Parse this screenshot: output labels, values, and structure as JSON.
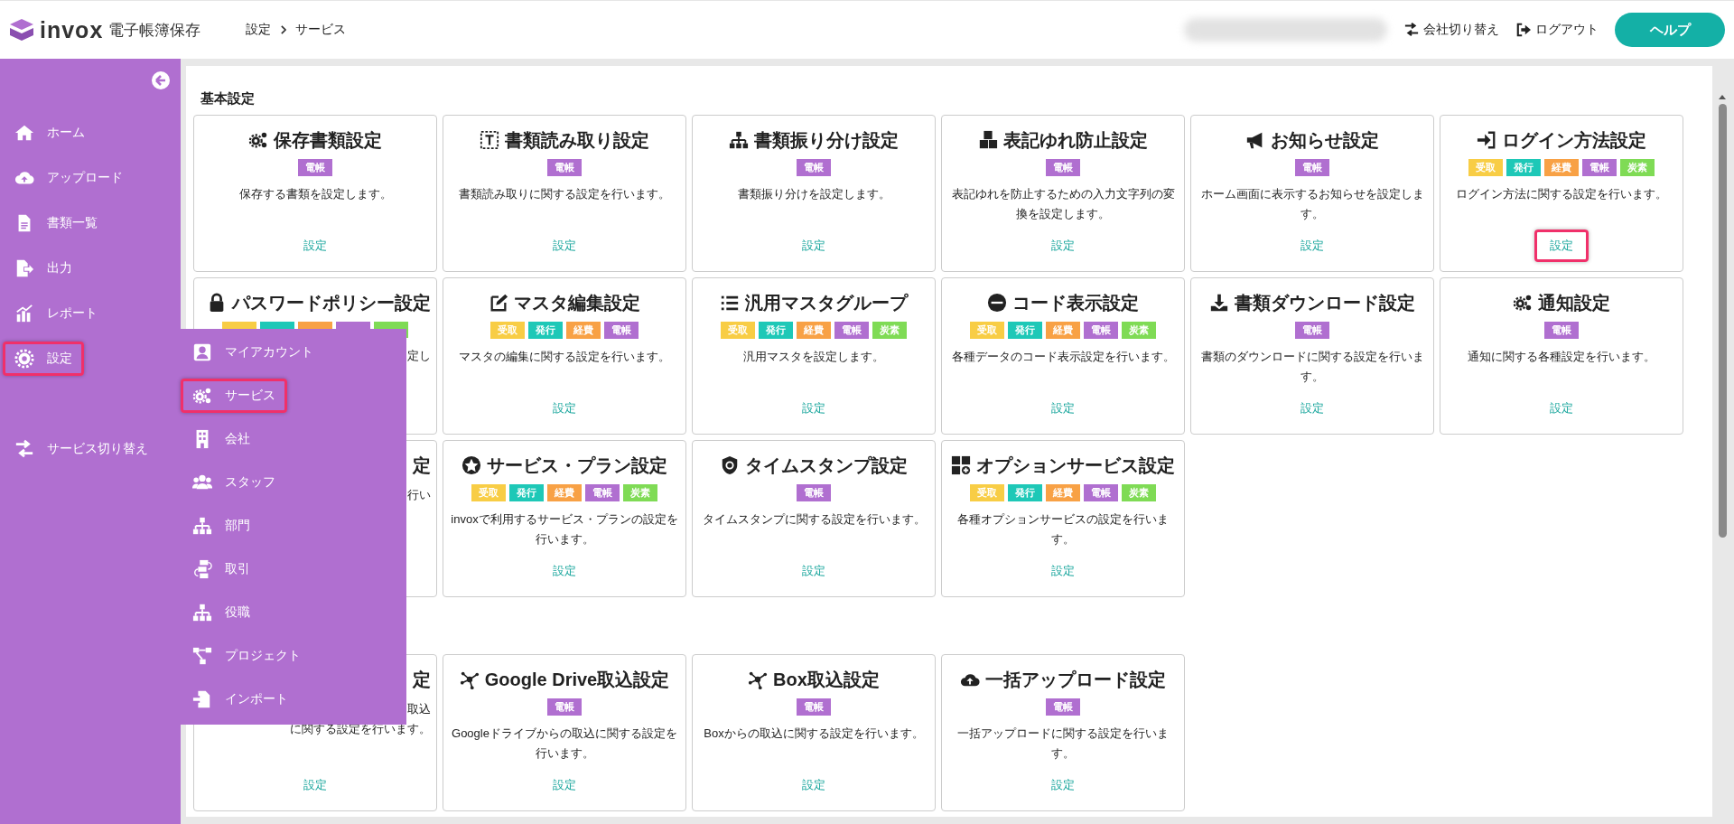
{
  "header": {
    "logo": {
      "brand": "invox",
      "product": "電子帳簿保存"
    },
    "breadcrumb": [
      "設定",
      "サービス"
    ],
    "actions": [
      {
        "label": "会社切り替え"
      },
      {
        "label": "ログアウト"
      }
    ],
    "help_button": "ヘルプ"
  },
  "sidebar": {
    "items": [
      {
        "label": "ホーム",
        "highlighted": false
      },
      {
        "label": "アップロード",
        "highlighted": false
      },
      {
        "label": "書類一覧",
        "highlighted": false
      },
      {
        "label": "出力",
        "highlighted": false
      },
      {
        "label": "レポート",
        "highlighted": false
      },
      {
        "label": "設定",
        "highlighted": true
      }
    ],
    "bottom_item": {
      "label": "サービス切り替え"
    }
  },
  "flyout_menu": {
    "items": [
      {
        "label": "マイアカウント",
        "highlighted": false
      },
      {
        "label": "サービス",
        "highlighted": true
      },
      {
        "label": "会社",
        "highlighted": false
      },
      {
        "label": "スタッフ",
        "highlighted": false
      },
      {
        "label": "部門",
        "highlighted": false
      },
      {
        "label": "取引",
        "highlighted": false
      },
      {
        "label": "役職",
        "highlighted": false
      },
      {
        "label": "プロジェクト",
        "highlighted": false
      },
      {
        "label": "インポート",
        "highlighted": false
      }
    ]
  },
  "card_groups": [
    {
      "heading": "基本設定",
      "cards": [
        {
          "kind": "full",
          "title": "保存書類設定",
          "tags": [
            {
              "label": "電帳",
              "color": "#b06fd0"
            }
          ],
          "description": "保存する書類を設定します。",
          "link": {
            "label": "設定",
            "highlighted": false
          }
        },
        {
          "kind": "full",
          "title": "書類読み取り設定",
          "tags": [
            {
              "label": "電帳",
              "color": "#b06fd0"
            }
          ],
          "description": "書類読み取りに関する設定を行います。",
          "link": {
            "label": "設定",
            "highlighted": false
          }
        },
        {
          "kind": "full",
          "title": "書類振り分け設定",
          "tags": [
            {
              "label": "電帳",
              "color": "#b06fd0"
            }
          ],
          "description": "書類振り分けを設定します。",
          "link": {
            "label": "設定",
            "highlighted": false
          }
        },
        {
          "kind": "full",
          "title": "表記ゆれ防止設定",
          "tags": [
            {
              "label": "電帳",
              "color": "#b06fd0"
            }
          ],
          "description": "表記ゆれを防止するための入力文字列の変換を設定します。",
          "link": {
            "label": "設定",
            "highlighted": false
          }
        },
        {
          "kind": "full",
          "title": "お知らせ設定",
          "tags": [
            {
              "label": "電帳",
              "color": "#b06fd0"
            }
          ],
          "description": "ホーム画面に表示するお知らせを設定します。",
          "link": {
            "label": "設定",
            "highlighted": false
          }
        },
        {
          "kind": "full",
          "title": "ログイン方法設定",
          "tags": [
            {
              "label": "受取",
              "color": "#f8cd45"
            },
            {
              "label": "発行",
              "color": "#1ec8b7"
            },
            {
              "label": "経費",
              "color": "#f8a145"
            },
            {
              "label": "電帳",
              "color": "#b06fd0"
            },
            {
              "label": "炭素",
              "color": "#7fdb55"
            }
          ],
          "description": "ログイン方法に関する設定を行います。",
          "link": {
            "label": "設定",
            "highlighted": true
          }
        },
        {
          "kind": "covered",
          "title": "パスワードポリシー設定",
          "tags": [
            {
              "color": "#f8cd45"
            },
            {
              "color": "#1ec8b7"
            },
            {
              "color": "#f8a145"
            },
            {
              "color": "#b06fd0"
            },
            {
              "color": "#7fdb55"
            }
          ],
          "description": "定し"
        },
        {
          "kind": "full",
          "title": "マスタ編集設定",
          "tags": [
            {
              "label": "受取",
              "color": "#f8cd45"
            },
            {
              "label": "発行",
              "color": "#1ec8b7"
            },
            {
              "label": "経費",
              "color": "#f8a145"
            },
            {
              "label": "電帳",
              "color": "#b06fd0"
            }
          ],
          "description": "マスタの編集に関する設定を行います。",
          "link": {
            "label": "設定",
            "highlighted": false
          }
        },
        {
          "kind": "full",
          "title": "汎用マスタグループ",
          "tags": [
            {
              "label": "受取",
              "color": "#f8cd45"
            },
            {
              "label": "発行",
              "color": "#1ec8b7"
            },
            {
              "label": "経費",
              "color": "#f8a145"
            },
            {
              "label": "電帳",
              "color": "#b06fd0"
            },
            {
              "label": "炭素",
              "color": "#7fdb55"
            }
          ],
          "description": "汎用マスタを設定します。",
          "link": {
            "label": "設定",
            "highlighted": false
          }
        },
        {
          "kind": "full",
          "title": "コード表示設定",
          "tags": [
            {
              "label": "受取",
              "color": "#f8cd45"
            },
            {
              "label": "発行",
              "color": "#1ec8b7"
            },
            {
              "label": "経費",
              "color": "#f8a145"
            },
            {
              "label": "電帳",
              "color": "#b06fd0"
            },
            {
              "label": "炭素",
              "color": "#7fdb55"
            }
          ],
          "description": "各種データのコード表示設定を行います。",
          "link": {
            "label": "設定",
            "highlighted": false
          }
        },
        {
          "kind": "full",
          "title": "書類ダウンロード設定",
          "tags": [
            {
              "label": "電帳",
              "color": "#b06fd0"
            }
          ],
          "description": "書類のダウンロードに関する設定を行います。",
          "link": {
            "label": "設定",
            "highlighted": false
          }
        },
        {
          "kind": "full",
          "title": "通知設定",
          "tags": [
            {
              "label": "電帳",
              "color": "#b06fd0"
            }
          ],
          "description": "通知に関する各種設定を行います。",
          "link": {
            "label": "設定",
            "highlighted": false
          }
        },
        {
          "kind": "covered",
          "title": "定",
          "description": "行い"
        },
        {
          "kind": "full",
          "title": "サービス・プラン設定",
          "tags": [
            {
              "label": "受取",
              "color": "#f8cd45"
            },
            {
              "label": "発行",
              "color": "#1ec8b7"
            },
            {
              "label": "経費",
              "color": "#f8a145"
            },
            {
              "label": "電帳",
              "color": "#b06fd0"
            },
            {
              "label": "炭素",
              "color": "#7fdb55"
            }
          ],
          "description": "invoxで利用するサービス・プランの設定を行います。",
          "link": {
            "label": "設定",
            "highlighted": false
          }
        },
        {
          "kind": "full",
          "title": "タイムスタンプ設定",
          "tags": [
            {
              "label": "電帳",
              "color": "#b06fd0"
            }
          ],
          "description": "タイムスタンプに関する設定を行います。",
          "link": {
            "label": "設定",
            "highlighted": false
          }
        },
        {
          "kind": "full",
          "title": "オプションサービス設定",
          "tags": [
            {
              "label": "受取",
              "color": "#f8cd45"
            },
            {
              "label": "発行",
              "color": "#1ec8b7"
            },
            {
              "label": "経費",
              "color": "#f8a145"
            },
            {
              "label": "電帳",
              "color": "#b06fd0"
            },
            {
              "label": "炭素",
              "color": "#7fdb55"
            }
          ],
          "description": "各種オプションサービスの設定を行います。",
          "link": {
            "label": "設定",
            "highlighted": false
          }
        }
      ]
    },
    {
      "cards": [
        {
          "kind": "covered",
          "title": "定",
          "description_lines": [
            "取込",
            "に関する設定を行います。"
          ],
          "link": {
            "label": "設定",
            "highlighted": false
          }
        },
        {
          "kind": "full",
          "title": "Google Drive取込設定",
          "tags": [
            {
              "label": "電帳",
              "color": "#b06fd0"
            }
          ],
          "description": "Googleドライブからの取込に関する設定を行います。",
          "link": {
            "label": "設定",
            "highlighted": false
          }
        },
        {
          "kind": "full",
          "title": "Box取込設定",
          "tags": [
            {
              "label": "電帳",
              "color": "#b06fd0"
            }
          ],
          "description": "Boxからの取込に関する設定を行います。",
          "link": {
            "label": "設定",
            "highlighted": false
          }
        },
        {
          "kind": "full",
          "title": "一括アップロード設定",
          "tags": [
            {
              "label": "電帳",
              "color": "#b06fd0"
            }
          ],
          "description": "一括アップロードに関する設定を行います。",
          "link": {
            "label": "設定",
            "highlighted": false
          }
        }
      ]
    }
  ]
}
